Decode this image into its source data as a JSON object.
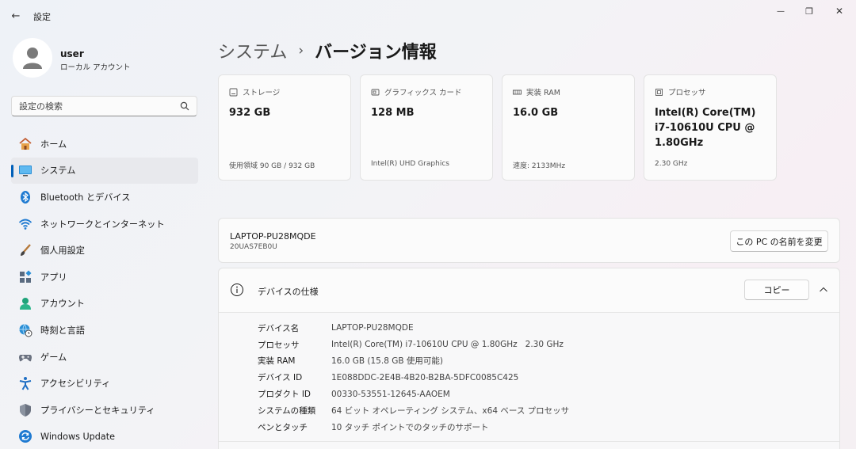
{
  "window": {
    "title": "設定",
    "back": "←",
    "minimize": "—",
    "maximize": "❐",
    "close": "✕"
  },
  "user": {
    "name": "user",
    "account_type": "ローカル アカウント"
  },
  "search": {
    "placeholder": "設定の検索"
  },
  "nav": [
    {
      "label": "ホーム",
      "icon": "home-icon"
    },
    {
      "label": "システム",
      "icon": "system-icon",
      "active": true
    },
    {
      "label": "Bluetooth とデバイス",
      "icon": "bluetooth-icon"
    },
    {
      "label": "ネットワークとインターネット",
      "icon": "wifi-icon"
    },
    {
      "label": "個人用設定",
      "icon": "brush-icon"
    },
    {
      "label": "アプリ",
      "icon": "apps-icon"
    },
    {
      "label": "アカウント",
      "icon": "account-icon"
    },
    {
      "label": "時刻と言語",
      "icon": "globe-clock-icon"
    },
    {
      "label": "ゲーム",
      "icon": "gamepad-icon"
    },
    {
      "label": "アクセシビリティ",
      "icon": "accessibility-icon"
    },
    {
      "label": "プライバシーとセキュリティ",
      "icon": "shield-icon"
    },
    {
      "label": "Windows Update",
      "icon": "update-icon"
    }
  ],
  "breadcrumb": {
    "parent": "システム",
    "separator": "›",
    "current": "バージョン情報"
  },
  "cards": [
    {
      "label": "ストレージ",
      "value": "932 GB",
      "sub": "使用領域 90 GB / 932 GB",
      "icon": "storage-icon"
    },
    {
      "label": "グラフィックス カード",
      "value": "128 MB",
      "sub": "Intel(R) UHD Graphics",
      "icon": "gpu-icon"
    },
    {
      "label": "実装 RAM",
      "value": "16.0 GB",
      "sub": "速度: 2133MHz",
      "icon": "ram-icon"
    },
    {
      "label": "プロセッサ",
      "value": "Intel(R) Core(TM) i7-10610U CPU @ 1.80GHz",
      "sub": "2.30 GHz",
      "icon": "cpu-icon"
    }
  ],
  "pc": {
    "name": "LAPTOP-PU28MQDE",
    "model": "20UAS7EB0U",
    "rename_label": "この PC の名前を変更"
  },
  "device_spec": {
    "title": "デバイスの仕様",
    "copy_label": "コピー",
    "rows": [
      {
        "key": "デバイス名",
        "value": "LAPTOP-PU28MQDE"
      },
      {
        "key": "プロセッサ",
        "value": "Intel(R) Core(TM) i7-10610U CPU @ 1.80GHz   2.30 GHz"
      },
      {
        "key": "実装 RAM",
        "value": "16.0 GB (15.8 GB 使用可能)"
      },
      {
        "key": "デバイス ID",
        "value": "1E088DDC-2E4B-4B20-B2BA-5DFC0085C425"
      },
      {
        "key": "プロダクト ID",
        "value": "00330-53551-12645-AAOEM"
      },
      {
        "key": "システムの種類",
        "value": "64 ビット オペレーティング システム、x64 ベース プロセッサ"
      },
      {
        "key": "ペンとタッチ",
        "value": "10 タッチ ポイントでのタッチのサポート"
      }
    ]
  },
  "colors": {
    "accent": "#005fb8"
  }
}
